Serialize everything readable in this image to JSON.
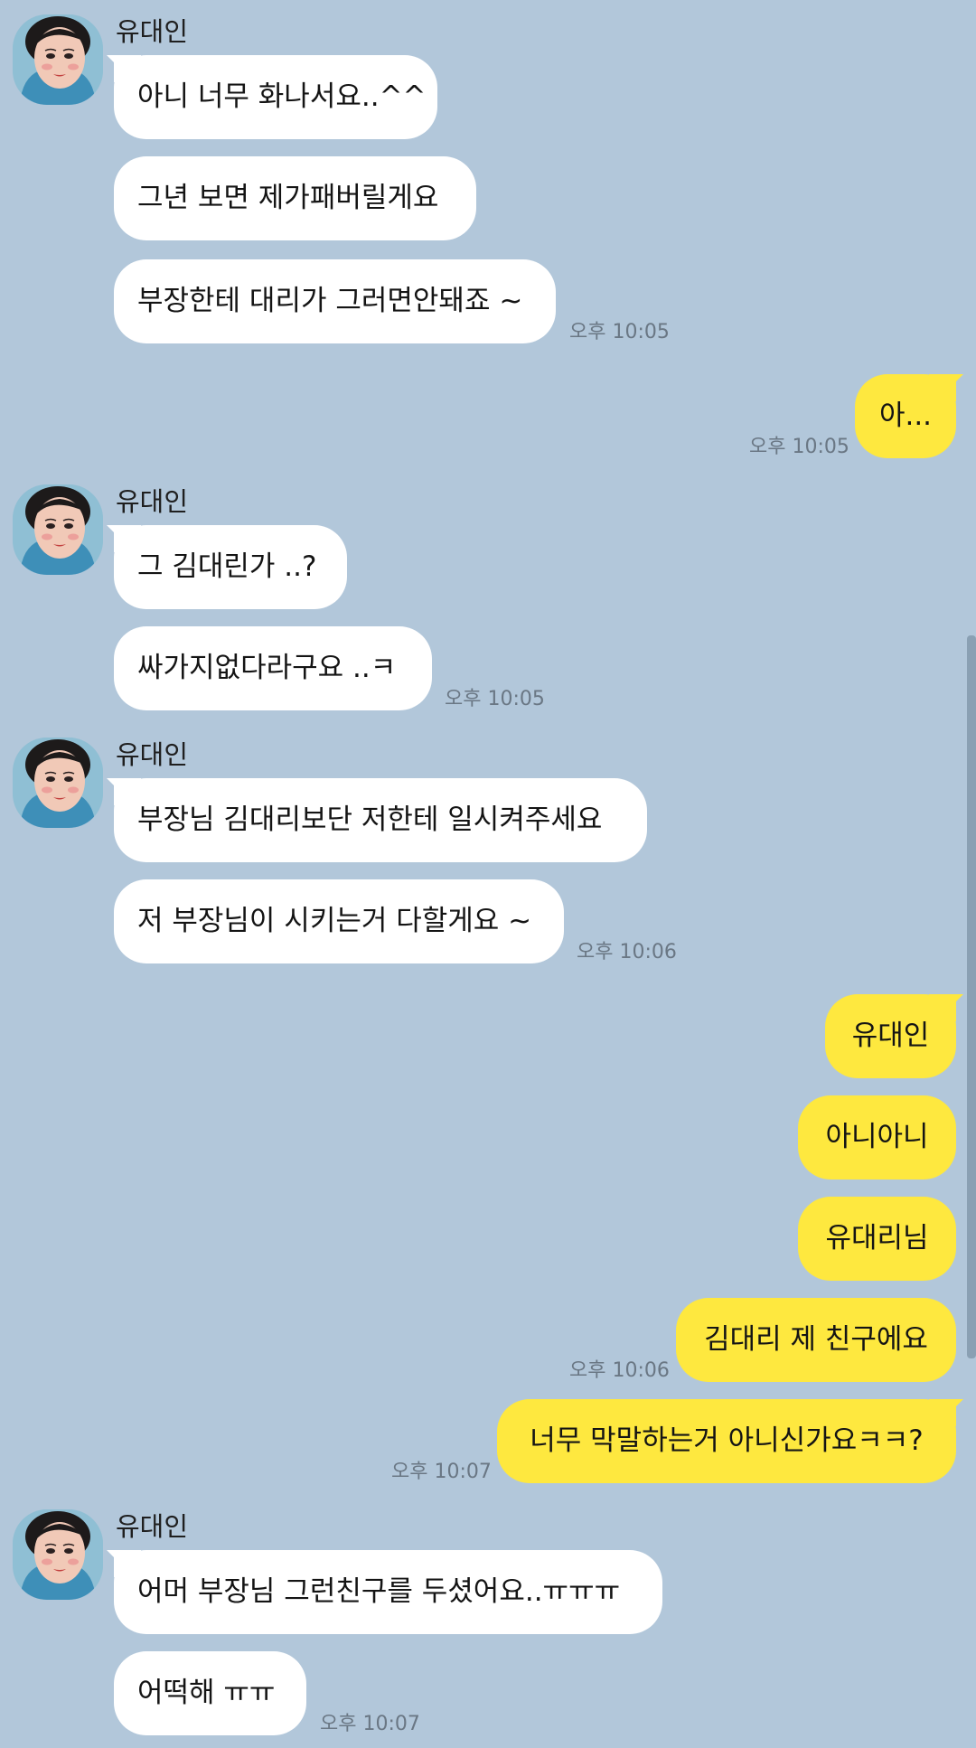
{
  "colors": {
    "background": "#b2c7da",
    "incoming_bubble": "#ffffff",
    "outgoing_bubble": "#fee83f",
    "time_text": "#6a7784"
  },
  "chat": {
    "groups": [
      {
        "sender": "유대인",
        "messages": [
          "아니 너무 화나서요..^^",
          "그년 보면 제가패버릴게요",
          "부장한테 대리가 그러면안돼죠 ~"
        ],
        "time": "오후 10:05"
      },
      {
        "outgoing": true,
        "messages": [
          "아..."
        ],
        "time": "오후 10:05"
      },
      {
        "sender": "유대인",
        "messages": [
          "그 김대린가 ..?",
          "싸가지없다라구요 ..ㅋ"
        ],
        "time": "오후 10:05"
      },
      {
        "sender": "유대인",
        "messages": [
          "부장님 김대리보단 저한테 일시켜주세요",
          "저 부장님이 시키는거 다할게요 ~"
        ],
        "time": "오후 10:06"
      },
      {
        "outgoing": true,
        "messages": [
          "유대인",
          "아니아니",
          "유대리님",
          "김대리 제 친구에요"
        ],
        "time": "오후 10:06"
      },
      {
        "outgoing": true,
        "messages": [
          "너무 막말하는거 아니신가요ㅋㅋ?"
        ],
        "time": "오후 10:07"
      },
      {
        "sender": "유대인",
        "messages": [
          "어머 부장님 그런친구를 두셨어요..ㅠㅠㅠ",
          "어떡해 ㅠㅠ"
        ],
        "time": "오후 10:07"
      }
    ]
  }
}
